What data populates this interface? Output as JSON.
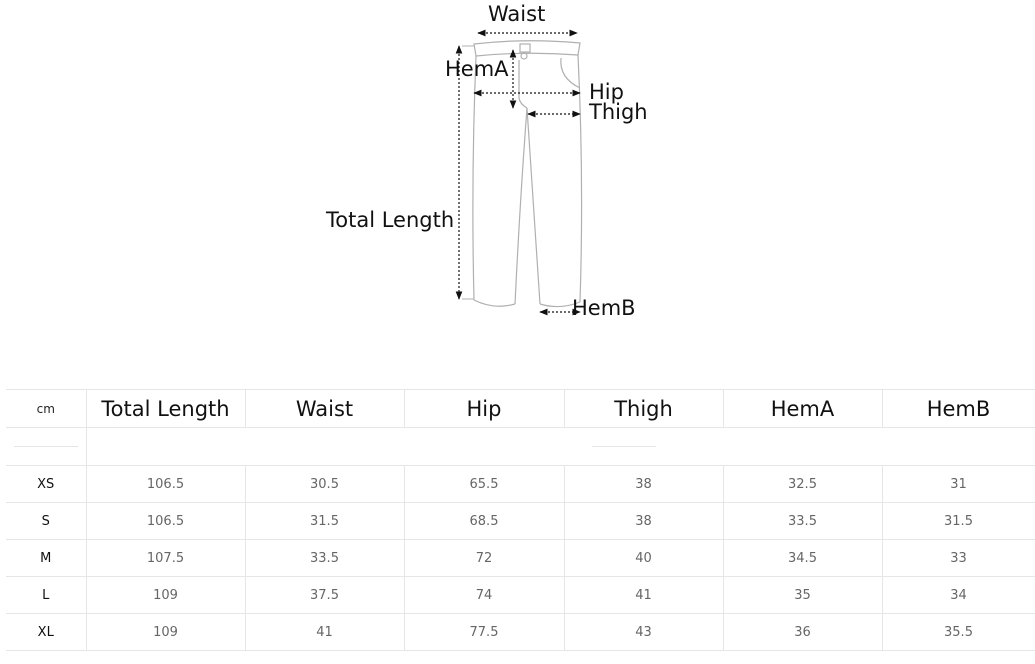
{
  "diagram": {
    "labels": {
      "waist": "Waist",
      "hem_a": "HemA",
      "hip": "Hip",
      "thigh": "Thigh",
      "total_length": "Total Length",
      "hem_b": "HemB"
    },
    "icon": "pants-outline-icon",
    "line_color": "#b0b0b0",
    "arrow_color": "#111111"
  },
  "table": {
    "unit": "cm",
    "headers": [
      "Total Length",
      "Waist",
      "Hip",
      "Thigh",
      "HemA",
      "HemB"
    ],
    "rows": [
      {
        "size": "XS",
        "values": [
          "106.5",
          "30.5",
          "65.5",
          "38",
          "32.5",
          "31"
        ]
      },
      {
        "size": "S",
        "values": [
          "106.5",
          "31.5",
          "68.5",
          "38",
          "33.5",
          "31.5"
        ]
      },
      {
        "size": "M",
        "values": [
          "107.5",
          "33.5",
          "72",
          "40",
          "34.5",
          "33"
        ]
      },
      {
        "size": "L",
        "values": [
          "109",
          "37.5",
          "74",
          "41",
          "35",
          "34"
        ]
      },
      {
        "size": "XL",
        "values": [
          "109",
          "41",
          "77.5",
          "43",
          "36",
          "35.5"
        ]
      }
    ],
    "border_color": "#e6e6e6"
  }
}
